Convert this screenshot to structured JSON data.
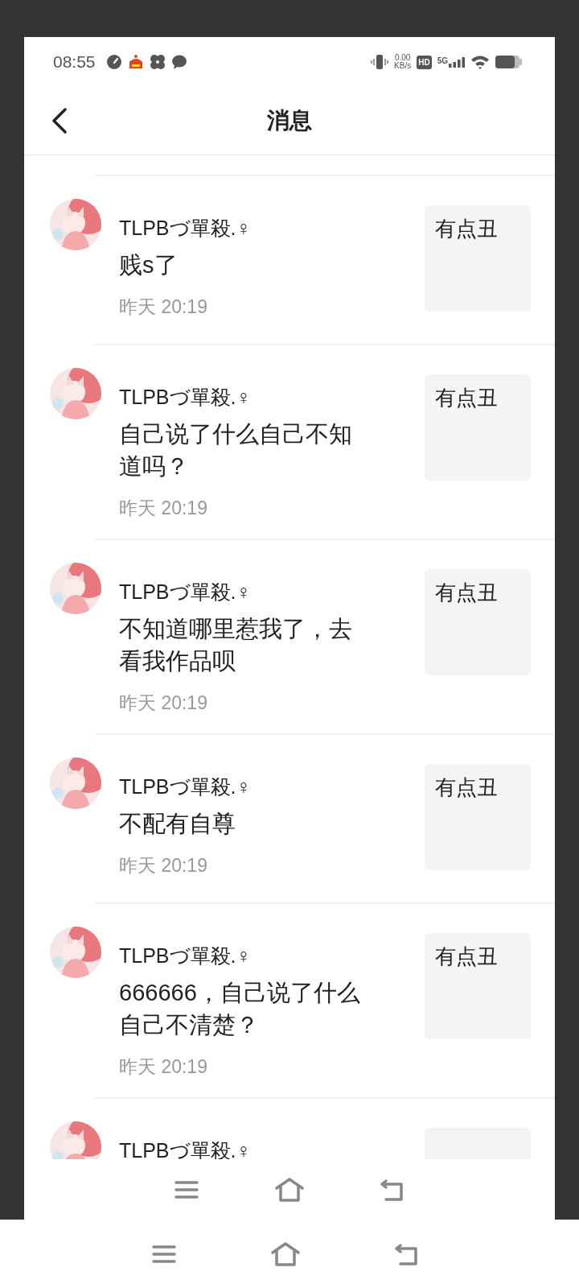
{
  "status_bar": {
    "time": "08:55",
    "net_speed": "0.00",
    "net_unit": "KB/s",
    "hd": "HD",
    "network": "5G"
  },
  "header": {
    "title": "消息"
  },
  "messages": [
    {
      "name": "TLPBづ單殺.♀",
      "text": "贱s了",
      "time": "昨天 20:19",
      "quote": "有点丑"
    },
    {
      "name": "TLPBづ單殺.♀",
      "text": "自己说了什么自己不知道吗？",
      "time": "昨天 20:19",
      "quote": "有点丑"
    },
    {
      "name": "TLPBづ單殺.♀",
      "text": "不知道哪里惹我了，去看我作品呗",
      "time": "昨天 20:19",
      "quote": "有点丑"
    },
    {
      "name": "TLPBづ單殺.♀",
      "text": "不配有自尊",
      "time": "昨天 20:19",
      "quote": "有点丑"
    },
    {
      "name": "TLPBづ單殺.♀",
      "text": "666666，自己说了什么自己不清楚？",
      "time": "昨天 20:19",
      "quote": "有点丑"
    },
    {
      "name": "TLPBづ單殺.♀"
    }
  ]
}
